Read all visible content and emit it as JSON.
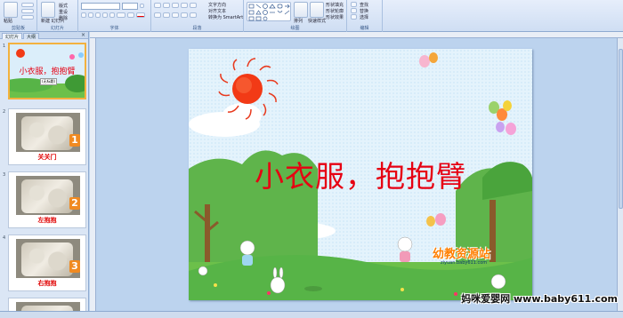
{
  "ribbon": {
    "groups": [
      {
        "label": "剪贴板"
      },
      {
        "label": "幻灯片"
      },
      {
        "label": "字体"
      },
      {
        "label": "段落"
      },
      {
        "label": "绘图"
      },
      {
        "label": "编辑"
      }
    ],
    "paste_label": "粘贴",
    "new_slide_label": "新建\n幻灯片",
    "layout_label": "版式",
    "reset_label": "重设",
    "delete_label": "删除",
    "text_direction_label": "文字方向",
    "align_text_label": "对齐文本",
    "smartart_label": "转换为 SmartArt",
    "arrange_label": "排列",
    "quick_styles_label": "快速样式",
    "shape_fill_label": "形状填充",
    "shape_outline_label": "形状轮廓",
    "shape_effects_label": "形状效果",
    "find_label": "查找",
    "replace_label": "替换",
    "select_label": "选择"
  },
  "left_panel": {
    "tabs": [
      "幻灯片",
      "大纲"
    ],
    "slides": [
      {
        "num": "1",
        "caption": "小衣服，抱抱臂",
        "selected": true
      },
      {
        "num": "2",
        "caption": "关关门",
        "badge": "1"
      },
      {
        "num": "3",
        "caption": "左抱抱",
        "badge": "2"
      },
      {
        "num": "4",
        "caption": "右抱抱",
        "badge": "3"
      }
    ],
    "thumb1_sub": "(无标题)"
  },
  "slide": {
    "title": "小衣服，抱抱臂",
    "logo_text": "幼教资源站",
    "logo_url": "ziyuan.baby611.com"
  },
  "watermark": "妈咪爱婴网 www.baby611.com",
  "colors": {
    "title_red": "#e60012",
    "ribbon_bg": "#dbe6f5",
    "grass": "#57b447",
    "sun": "#f23a16"
  }
}
